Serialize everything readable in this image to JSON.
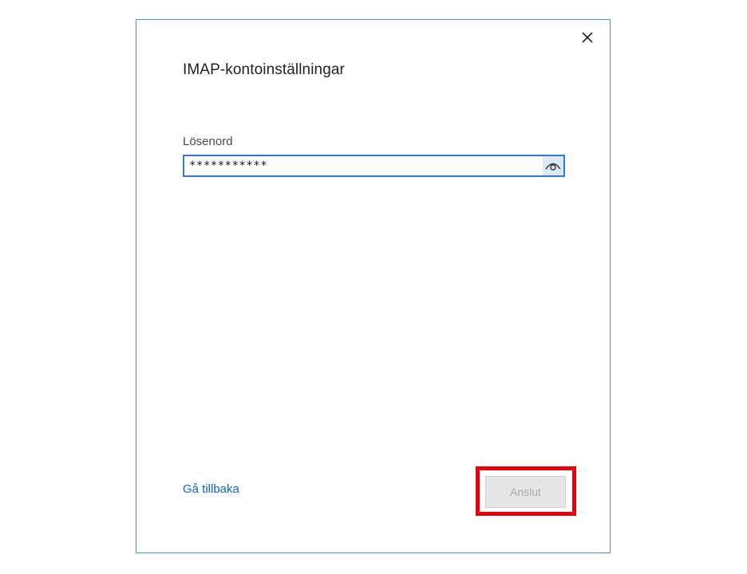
{
  "dialog": {
    "title": "IMAP-kontoinställningar",
    "close_icon": "close-icon"
  },
  "password": {
    "label": "Lösenord",
    "value": "***********",
    "reveal_icon": "eye-icon"
  },
  "footer": {
    "back_link": "Gå tillbaka",
    "connect_button": "Anslut",
    "connect_enabled": false
  },
  "colors": {
    "accent": "#2f7bd3",
    "link": "#0b67c2",
    "highlight": "#e5000b",
    "disabled_button_bg": "#e6e6e6"
  }
}
